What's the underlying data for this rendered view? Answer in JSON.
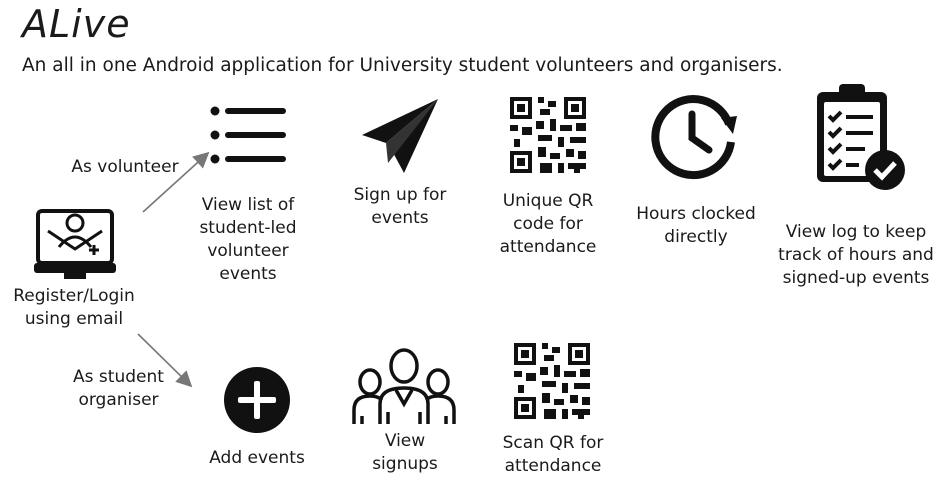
{
  "app": {
    "title": "ALive",
    "subtitle": "An all in one Android application for University student volunteers and organisers."
  },
  "entry": {
    "label": "Register/Login\nusing email"
  },
  "volunteer": {
    "role_label": "As volunteer",
    "steps": [
      {
        "label": "View list of\nstudent-led\nvolunteer\nevents",
        "icon": "list-icon"
      },
      {
        "label": "Sign up for\nevents",
        "icon": "paper-plane-icon"
      },
      {
        "label": "Unique QR\ncode for\nattendance",
        "icon": "qr-code-icon"
      },
      {
        "label": "Hours clocked\ndirectly",
        "icon": "clock-icon"
      },
      {
        "label": "View log to keep\ntrack of hours and\nsigned-up events",
        "icon": "clipboard-check-icon"
      }
    ]
  },
  "organiser": {
    "role_label": "As student\norganiser",
    "steps": [
      {
        "label": "Add events",
        "icon": "plus-circle-icon"
      },
      {
        "label": "View\nsignups",
        "icon": "people-icon"
      },
      {
        "label": "Scan QR for\nattendance",
        "icon": "qr-code-icon"
      }
    ]
  },
  "colors": {
    "text": "#1a1a1a",
    "icon": "#111111",
    "arrow": "#777777"
  }
}
